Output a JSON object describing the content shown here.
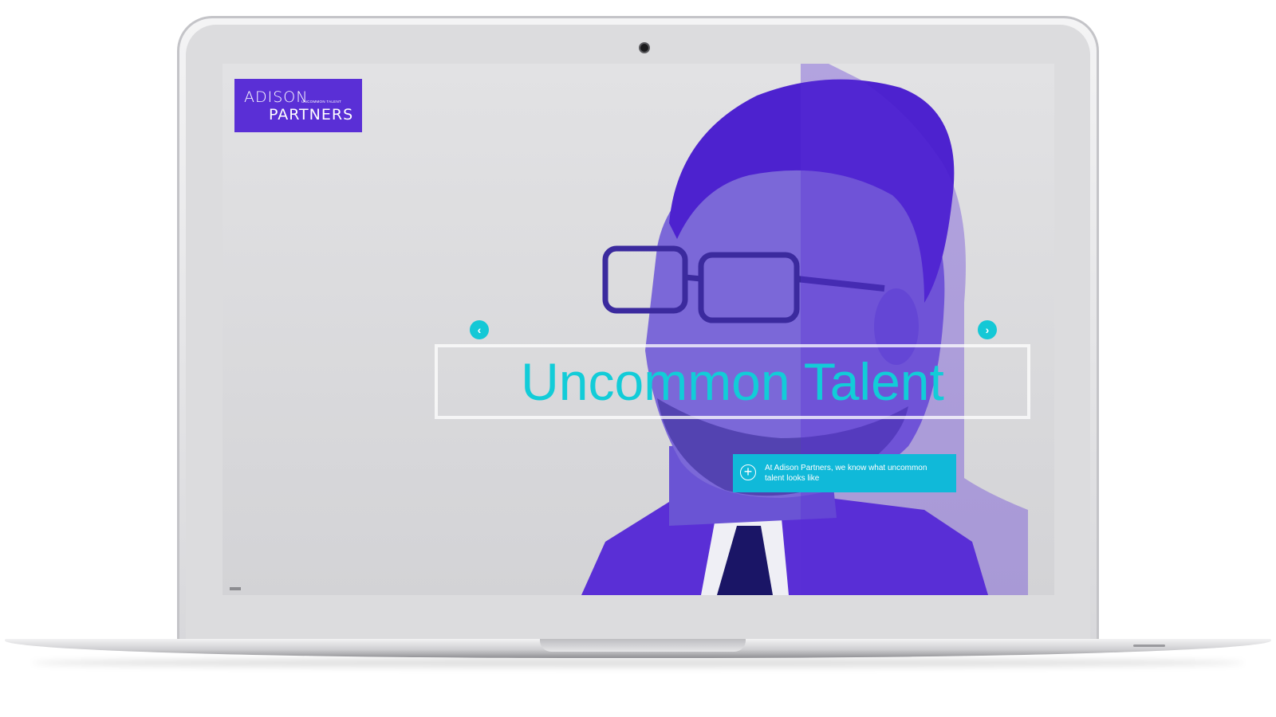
{
  "brand": {
    "name_line1": "ADISON",
    "name_line2": "PARTNERS",
    "tagline": "UNCOMMON TALENT",
    "color": "#5a2fd6"
  },
  "hero": {
    "headline": "Uncommon Talent",
    "headline_color": "#12ccd8",
    "prev_icon": "chevron-left-icon",
    "next_icon": "chevron-right-icon",
    "prev_glyph": "‹",
    "next_glyph": "›"
  },
  "cta": {
    "icon": "plus-circle-icon",
    "glyph": "+",
    "text": "At Adison Partners, we know what uncommon talent looks like",
    "color": "#10b9d9"
  },
  "device": {
    "type": "laptop",
    "camera_icon": "camera-icon"
  }
}
